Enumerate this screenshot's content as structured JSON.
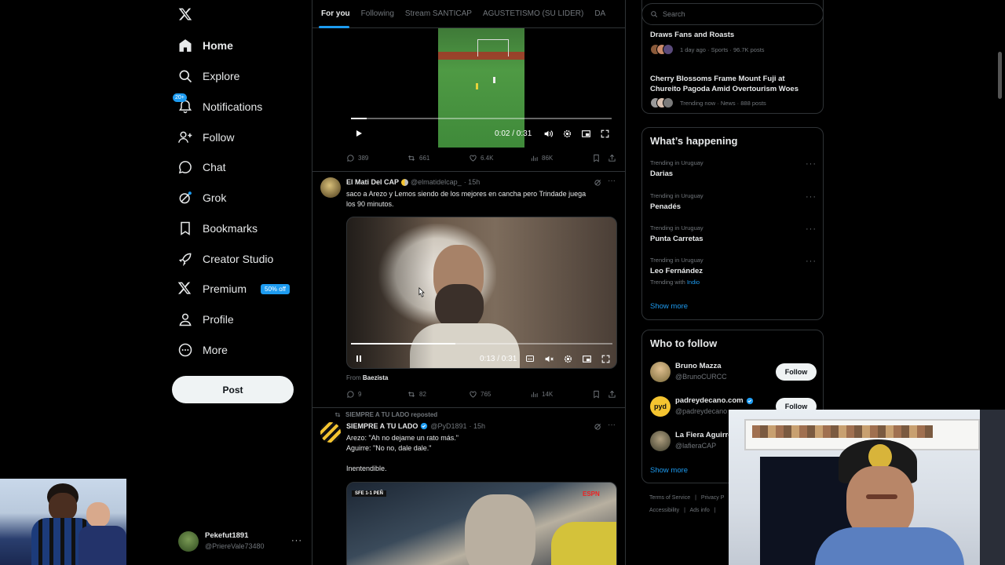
{
  "nav": {
    "logo": "x-logo",
    "items": [
      {
        "label": "Home",
        "icon": "home-icon"
      },
      {
        "label": "Explore",
        "icon": "search-icon"
      },
      {
        "label": "Notifications",
        "icon": "bell-icon",
        "badge": "20+"
      },
      {
        "label": "Follow",
        "icon": "person-add-icon"
      },
      {
        "label": "Chat",
        "icon": "chat-icon"
      },
      {
        "label": "Grok",
        "icon": "grok-icon"
      },
      {
        "label": "Bookmarks",
        "icon": "bookmark-icon"
      },
      {
        "label": "Creator Studio",
        "icon": "rocket-icon"
      },
      {
        "label": "Premium",
        "icon": "x-icon",
        "promo": "50% off"
      },
      {
        "label": "Profile",
        "icon": "person-icon"
      },
      {
        "label": "More",
        "icon": "more-circle-icon"
      }
    ],
    "post_label": "Post",
    "account": {
      "name": "Pekefut1891",
      "handle": "@PriereVale73480"
    }
  },
  "tabs": [
    "For you",
    "Following",
    "Stream SANTICAP",
    "AGUSTETISMO (SU LIDER)",
    "DA"
  ],
  "tweet1": {
    "video_time": "0:02 / 0:31",
    "progress": 0.06,
    "replies": "389",
    "reposts": "661",
    "likes": "6.4K",
    "views": "86K"
  },
  "tweet2": {
    "name": "El Mati Del CAP",
    "handle": "@elmatidelcap_",
    "time": "· 15h",
    "text_line1": "saco a Arezo y Lemos siendo de los mejores en cancha pero Trindade juega",
    "text_line2": "los 90 minutos.",
    "video_time": "0:13 / 0:31",
    "progress": 0.4,
    "from_label": "From",
    "from_name": "Baezista",
    "replies": "9",
    "reposts": "82",
    "likes": "765",
    "views": "14K"
  },
  "tweet3": {
    "repost_label": "SIEMPRE A TU LADO reposted",
    "name": "SIEMPRE A TU LADO",
    "handle": "@PyD1891",
    "time": "· 15h",
    "line1": "Arezo: \"Ah no dejame un rato más.\"",
    "line2": "Aguirre: \"No no, dale dale.\"",
    "line3": "Inentendible.",
    "score": "SFE 1-1 PEÑ",
    "tv": "ESPN"
  },
  "search": {
    "placeholder": "Search"
  },
  "top_trends": [
    {
      "title": "Draws Fans and Roasts",
      "meta": "1 day ago · Sports · 96.7K posts"
    },
    {
      "title_line1": "Cherry Blossoms Frame Mount Fuji at",
      "title_line2": "Chureito Pagoda Amid Overtourism Woes",
      "meta": "Trending now · News · 888 posts"
    }
  ],
  "happening": {
    "heading": "What’s happening",
    "trends": [
      {
        "meta": "Trending in Uruguay",
        "name": "Darias"
      },
      {
        "meta": "Trending in Uruguay",
        "name": "Penadés"
      },
      {
        "meta": "Trending in Uruguay",
        "name": "Punta Carretas"
      },
      {
        "meta": "Trending in Uruguay",
        "name": "Leo Fernández",
        "with_label": "Trending with",
        "with_value": "Indio"
      }
    ],
    "show_more": "Show more"
  },
  "who_to_follow": {
    "heading": "Who to follow",
    "people": [
      {
        "name": "Bruno Mazza",
        "handle": "@BrunoCURCC"
      },
      {
        "name": "padreydecano.com",
        "handle": "@padreydecano"
      },
      {
        "name": "La Fiera Aguirre",
        "handle": "@lafieraCAP"
      }
    ],
    "follow_label": "Follow",
    "show_more": "Show more"
  },
  "footer": {
    "line1_a": "Terms of Service",
    "line1_b": "Privacy P",
    "line2_a": "Accessibility",
    "line2_b": "Ads info"
  },
  "colors": {
    "accent": "#1d9bf0",
    "bg": "#000000",
    "border": "#2f3336",
    "muted": "#71767b"
  }
}
